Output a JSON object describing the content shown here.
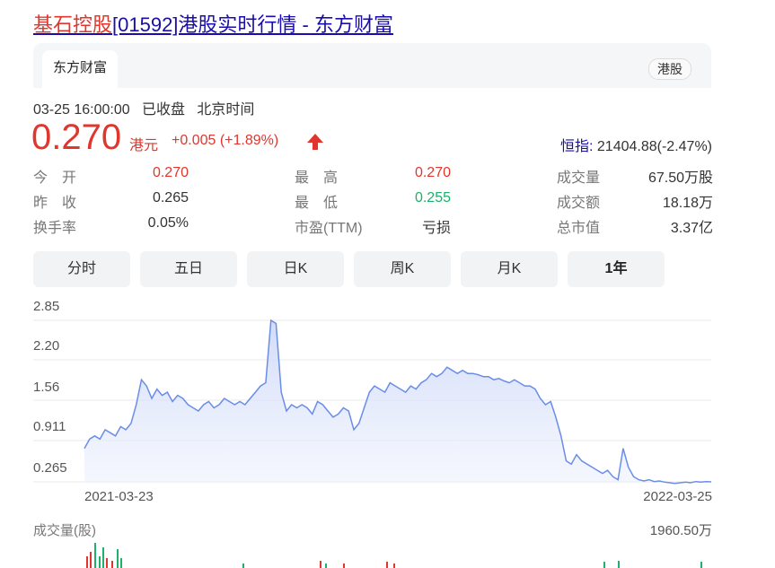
{
  "page": {
    "title_highlight": "基石控股",
    "title_rest": "[01592]港股实时行情 - 东方财富"
  },
  "header": {
    "source_tab": "东方财富",
    "market_pill": "港股"
  },
  "quote": {
    "timestamp": "03-25 16:00:00",
    "status": "已收盘",
    "timezone": "北京时间",
    "price": "0.270",
    "currency": "港元",
    "change": "+0.005 (+1.89%)",
    "index_label": "恒指:",
    "index_value": "21404.88(-2.47%)"
  },
  "stats": {
    "open_label": "今　开",
    "open": "0.270",
    "prev_close_label": "昨　收",
    "prev_close": "0.265",
    "turnover_rate_label": "换手率",
    "turnover_rate": "0.05%",
    "high_label": "最　高",
    "high": "0.270",
    "low_label": "最　低",
    "low": "0.255",
    "pe_label": "市盈(TTM)",
    "pe": "亏损",
    "volume_label": "成交量",
    "volume": "67.50万股",
    "amount_label": "成交额",
    "amount": "18.18万",
    "mktcap_label": "总市值",
    "mktcap": "3.37亿"
  },
  "tabs": [
    "分时",
    "五日",
    "日K",
    "周K",
    "月K",
    "1年"
  ],
  "active_tab": "1年",
  "colors": {
    "up": "#e0362d",
    "down": "#1db16b",
    "line": "#6a8de8",
    "link": "#1a0dab"
  },
  "chart_data": {
    "type": "area",
    "y_ticks": [
      "2.85",
      "2.20",
      "1.56",
      "0.911",
      "0.265"
    ],
    "ylim": [
      0.265,
      2.85
    ],
    "x_start_label": "2021-03-23",
    "x_end_label": "2022-03-25",
    "values": [
      0.8,
      0.95,
      1.0,
      0.95,
      1.1,
      1.05,
      1.0,
      1.15,
      1.1,
      1.2,
      1.5,
      1.9,
      1.8,
      1.6,
      1.75,
      1.65,
      1.7,
      1.55,
      1.65,
      1.6,
      1.5,
      1.45,
      1.4,
      1.5,
      1.55,
      1.45,
      1.5,
      1.6,
      1.55,
      1.5,
      1.55,
      1.5,
      1.6,
      1.7,
      1.8,
      1.85,
      2.85,
      2.8,
      1.7,
      1.4,
      1.5,
      1.45,
      1.5,
      1.45,
      1.35,
      1.55,
      1.5,
      1.4,
      1.3,
      1.35,
      1.45,
      1.4,
      1.1,
      1.2,
      1.45,
      1.7,
      1.8,
      1.75,
      1.7,
      1.85,
      1.8,
      1.75,
      1.7,
      1.8,
      1.75,
      1.85,
      1.9,
      2.0,
      1.95,
      2.0,
      2.1,
      2.05,
      2.0,
      2.05,
      2.0,
      2.0,
      1.98,
      1.95,
      1.95,
      1.9,
      1.92,
      1.88,
      1.85,
      1.9,
      1.85,
      1.8,
      1.8,
      1.75,
      1.6,
      1.5,
      1.55,
      1.3,
      1.0,
      0.6,
      0.55,
      0.7,
      0.6,
      0.55,
      0.5,
      0.45,
      0.4,
      0.45,
      0.35,
      0.3,
      0.8,
      0.5,
      0.35,
      0.3,
      0.28,
      0.3,
      0.27,
      0.28,
      0.26,
      0.25,
      0.24,
      0.25,
      0.26,
      0.25,
      0.27,
      0.26,
      0.27,
      0.265
    ],
    "volume_title": "成交量(股)",
    "volume_max": "1960.50万"
  }
}
